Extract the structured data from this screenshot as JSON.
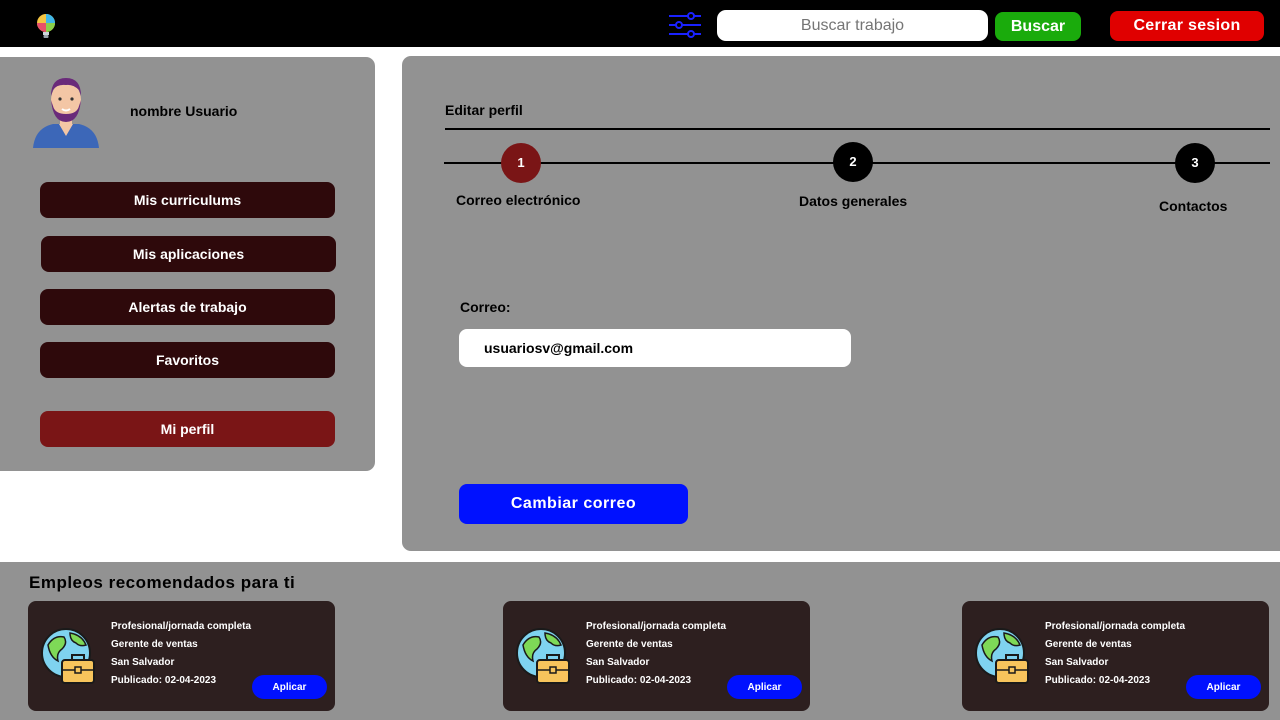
{
  "header": {
    "logo_icon": "lightbulb-palette-icon",
    "filter_icon": "sliders-icon",
    "search_placeholder": "Buscar trabajo",
    "search_button": "Buscar",
    "logout_button": "Cerrar sesion",
    "colors": {
      "bar": "#000000",
      "search": "#1aab0c",
      "logout": "#e00000"
    }
  },
  "sidebar": {
    "avatar_icon": "user-avatar-icon",
    "username": "nombre Usuario",
    "items": [
      {
        "label": "Mis curriculums",
        "active": false
      },
      {
        "label": "Mis aplicaciones",
        "active": false
      },
      {
        "label": "Alertas de trabajo",
        "active": false
      },
      {
        "label": "Favoritos",
        "active": false
      },
      {
        "label": "Mi perfil",
        "active": true
      }
    ]
  },
  "main": {
    "title": "Editar perfil",
    "steps": [
      {
        "number": "1",
        "label": "Correo electrónico",
        "active": true
      },
      {
        "number": "2",
        "label": "Datos generales",
        "active": false
      },
      {
        "number": "3",
        "label": "Contactos",
        "active": false
      }
    ],
    "email_label": "Correo:",
    "email_value": "usuariosv@gmail.com",
    "change_button": "Cambiar correo",
    "colors": {
      "active_step": "#7a1516",
      "primary_button": "#0011ff"
    }
  },
  "recommendations": {
    "title": "Empleos recomendados para ti",
    "jobs": [
      {
        "icon": "globe-briefcase-icon",
        "type": "Profesional/jornada completa",
        "position": "Gerente de ventas",
        "location": "San Salvador",
        "published": "Publicado: 02-04-2023",
        "apply_label": "Aplicar"
      },
      {
        "icon": "globe-briefcase-icon",
        "type": "Profesional/jornada completa",
        "position": "Gerente de ventas",
        "location": "San Salvador",
        "published": "Publicado: 02-04-2023",
        "apply_label": "Aplicar"
      },
      {
        "icon": "globe-briefcase-icon",
        "type": "Profesional/jornada completa",
        "position": "Gerente de ventas",
        "location": "San Salvador",
        "published": "Publicado: 02-04-2023",
        "apply_label": "Aplicar"
      }
    ]
  }
}
